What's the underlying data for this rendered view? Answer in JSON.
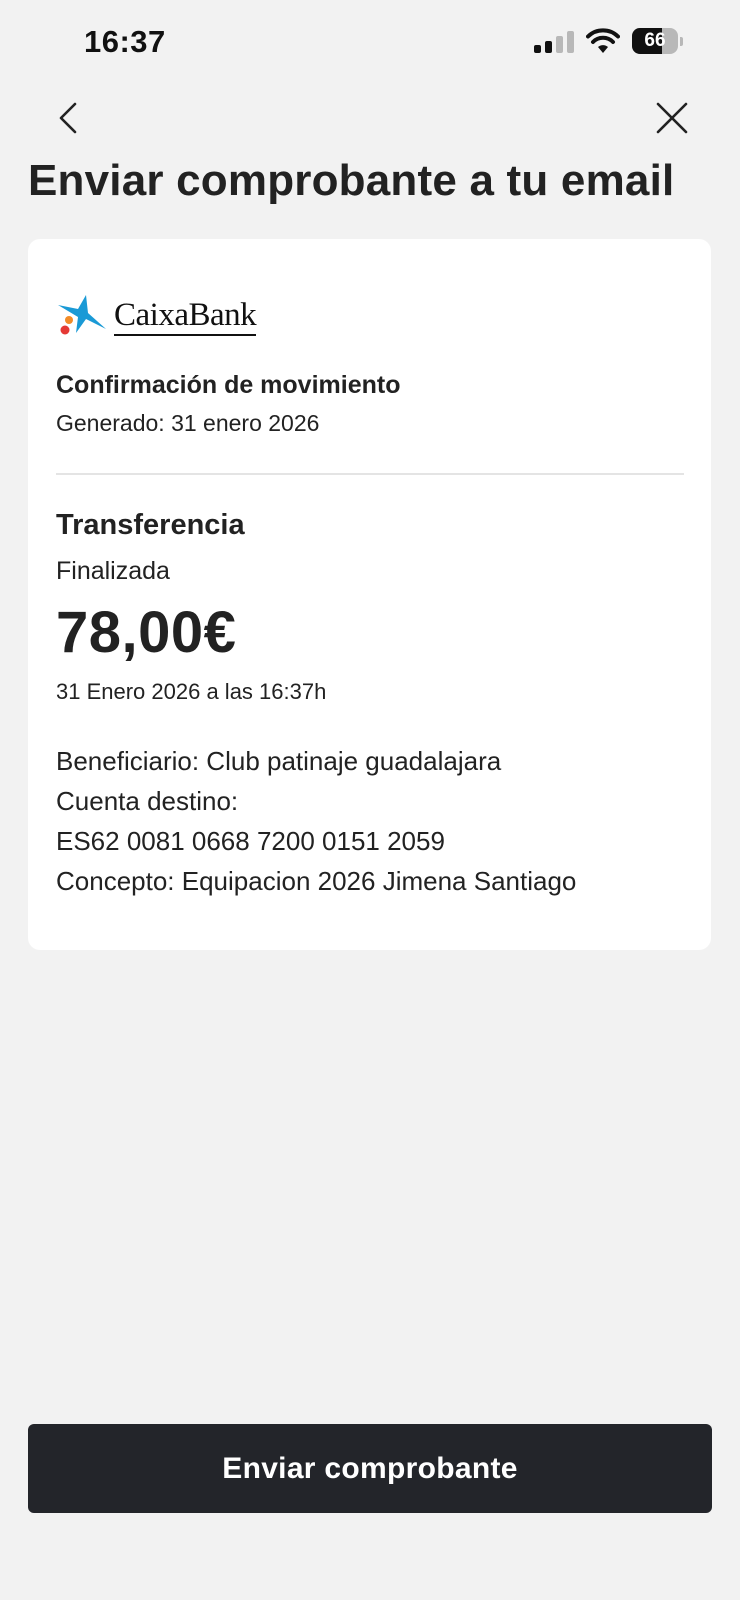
{
  "status_bar": {
    "time": "16:37",
    "battery": "66",
    "battery_level": 0.66,
    "icons": [
      "signal-icon",
      "wifi-icon",
      "battery-icon"
    ]
  },
  "nav": {
    "back_icon": "chevron-left-icon",
    "close_icon": "close-icon"
  },
  "page_title": "Enviar comprobante a tu email",
  "receipt": {
    "bank_name": "CaixaBank",
    "logo_colors": {
      "star": "#1a9ad6",
      "dot_orange": "#f28c28",
      "dot_red": "#e53935"
    },
    "title": "Confirmación de movimiento",
    "generated": "Generado: 31 enero 2026",
    "type": "Transferencia",
    "status": "Finalizada",
    "amount": "78,00€",
    "datetime": "31 Enero 2026 a las 16:37h",
    "details": {
      "beneficiary": "Beneficiario: Club patinaje guadalajara",
      "account_label": "Cuenta destino:",
      "account_number": "ES62 0081 0668 7200 0151 2059",
      "concept": "Concepto: Equipacion 2026 Jimena Santiago"
    }
  },
  "send_button_label": "Enviar comprobante",
  "colors": {
    "background": "#f2f2f2",
    "card": "#ffffff",
    "button": "#23252a",
    "text": "#222222"
  }
}
